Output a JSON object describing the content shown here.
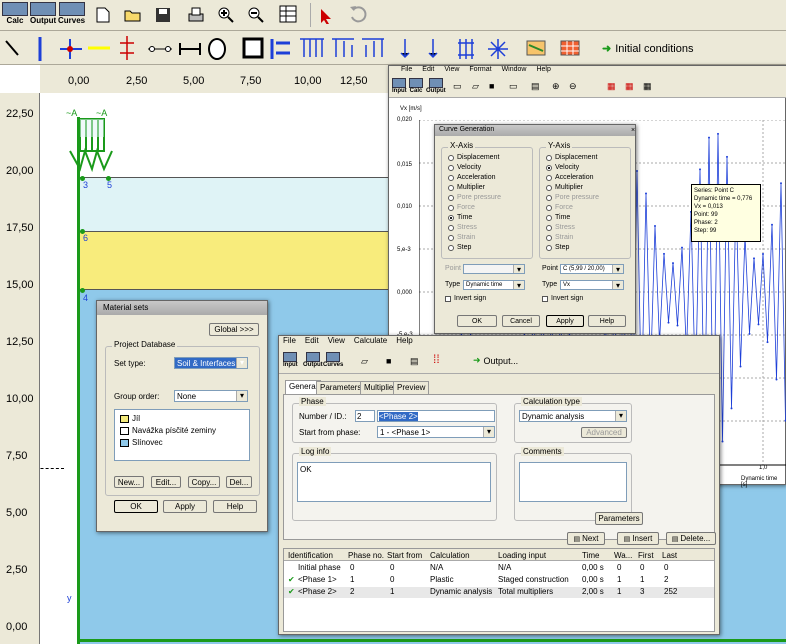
{
  "toolbar1": {
    "buttons": [
      {
        "label": "Calc"
      },
      {
        "label": "Output"
      },
      {
        "label": "Curves"
      }
    ],
    "icons": [
      "new-icon",
      "open-icon",
      "save-icon",
      "print-icon",
      "zoom-in-icon",
      "zoom-out-icon",
      "table-icon",
      "pointer-icon",
      "undo-icon"
    ]
  },
  "toolbar2": {
    "initial_conditions": "Initial conditions"
  },
  "ruler_x": [
    "0,00",
    "2,50",
    "5,00",
    "7,50",
    "10,00",
    "12,50"
  ],
  "ruler_y": [
    "22,50",
    "20,00",
    "17,50",
    "15,00",
    "12,50",
    "10,00",
    "7,50",
    "5,00",
    "2,50",
    "0,00"
  ],
  "geometry_labels": {
    "a1": "~A",
    "a2": "~A",
    "p3": "3",
    "p5": "5",
    "p6": "6",
    "p4": "4",
    "y": "y"
  },
  "curves_menu": [
    "File",
    "Edit",
    "View",
    "Format",
    "Window",
    "Help"
  ],
  "curves_toolbar": [
    "Input",
    "Calc",
    "Output"
  ],
  "chart_ylabel": "Vx [m/s]",
  "chart_yticks": [
    "0,020",
    "0,015",
    "0,010",
    "5,e-3",
    "0,000",
    "-5,e-3"
  ],
  "chart_xlabel": "Dynamic time [s]",
  "chart_xtick": "1,0",
  "tooltip": [
    "Series: Point C",
    "Dynamic time = 0,776",
    "Vx = 0,013",
    "Point: 99",
    "Phase: 2",
    "Step: 99"
  ],
  "curve_gen": {
    "title": "Curve Generation",
    "xaxis": "X-Axis",
    "yaxis": "Y-Axis",
    "options": [
      "Displacement",
      "Velocity",
      "Acceleration",
      "Multiplier",
      "Pore pressure",
      "Force",
      "Time",
      "Stress",
      "Strain",
      "Step"
    ],
    "point_label": "Point",
    "x_point": "",
    "y_point": "C (5,99 / 20,00)",
    "type_label": "Type",
    "x_type": "Dynamic time",
    "y_type": "Vx",
    "invert": "Invert sign",
    "ok": "OK",
    "cancel": "Cancel",
    "apply": "Apply",
    "help": "Help"
  },
  "material": {
    "title": "Material sets",
    "global": "Global >>>",
    "group_title": "Project Database",
    "set_type_label": "Set type:",
    "set_type": "Soil & Interfaces",
    "group_order_label": "Group order:",
    "group_order": "None",
    "items": [
      {
        "name": "Jíl",
        "color": "#f3ea7c"
      },
      {
        "name": "Navážka písčité zeminy",
        "color": "#ffffff"
      },
      {
        "name": "Slínovec",
        "color": "#8fc9ea"
      }
    ],
    "new": "New...",
    "edit": "Edit...",
    "copy": "Copy...",
    "del": "Del...",
    "ok": "OK",
    "apply": "Apply",
    "help": "Help"
  },
  "calc": {
    "menu": [
      "File",
      "Edit",
      "View",
      "Calculate",
      "Help"
    ],
    "toolbar": [
      "Input",
      "Output",
      "Curves"
    ],
    "output": "Output...",
    "tabs": [
      "General",
      "Parameters",
      "Multipliers",
      "Preview"
    ],
    "phase_group": "Phase",
    "number_label": "Number / ID.:",
    "number": "2",
    "id": "<Phase 2>",
    "start_label": "Start from phase:",
    "start": "1 - <Phase 1>",
    "calc_type_group": "Calculation type",
    "calc_type": "Dynamic analysis",
    "advanced": "Advanced",
    "log_group": "Log info",
    "log": "OK",
    "comments_group": "Comments",
    "parameters": "Parameters",
    "next": "Next",
    "insert": "Insert",
    "delete": "Delete...",
    "columns": [
      "Identification",
      "Phase no.",
      "Start from",
      "Calculation",
      "Loading input",
      "Time",
      "Wa...",
      "First",
      "Last"
    ],
    "rows": [
      {
        "check": "",
        "id": "Initial phase",
        "no": "0",
        "start": "0",
        "calc": "N/A",
        "load": "N/A",
        "time": "0,00 s",
        "wa": "0",
        "first": "0",
        "last": "0"
      },
      {
        "check": "✔",
        "id": "<Phase 1>",
        "no": "1",
        "start": "0",
        "calc": "Plastic",
        "load": "Staged construction",
        "time": "0,00 s",
        "wa": "1",
        "first": "1",
        "last": "2"
      },
      {
        "check": "✔",
        "id": "<Phase 2>",
        "no": "2",
        "start": "1",
        "calc": "Dynamic analysis",
        "load": "Total multipliers",
        "time": "2,00 s",
        "wa": "1",
        "first": "3",
        "last": "252"
      }
    ]
  }
}
